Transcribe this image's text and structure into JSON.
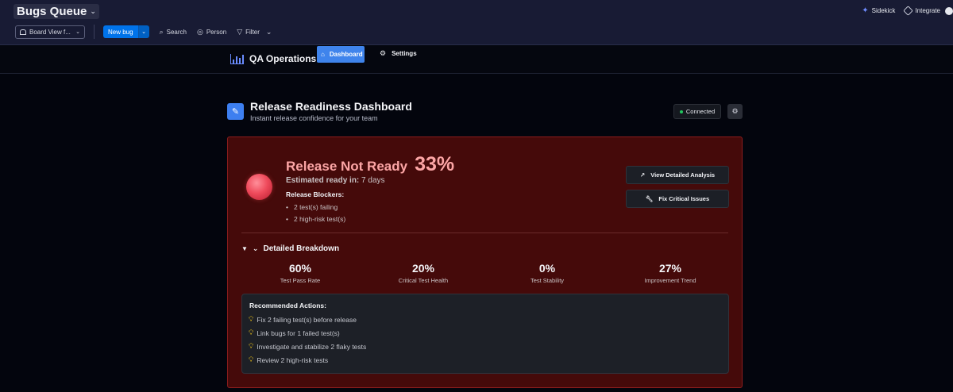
{
  "board": {
    "title": "Bugs Queue",
    "view_label": "Board View f...",
    "new_bug_label": "New bug",
    "search_label": "Search",
    "person_label": "Person",
    "filter_label": "Filter",
    "sidekick_label": "Sidekick",
    "integrate_label": "Integrate"
  },
  "app": {
    "brand": "QA Operations",
    "tabs": [
      {
        "label": "Dashboard",
        "active": true
      },
      {
        "label": "Settings",
        "active": false
      }
    ]
  },
  "dashboard": {
    "title": "Release Readiness Dashboard",
    "subtitle": "Instant release confidence for your team",
    "connection_status": "Connected",
    "status_color": "#22c55e"
  },
  "release": {
    "status_label": "Release Not Ready",
    "percent": "33%",
    "eta_label": "Estimated ready in:",
    "eta_value": "7 days",
    "blockers_title": "Release Blockers:",
    "blockers": [
      "2 test(s) failing",
      "2 high-risk test(s)"
    ],
    "actions": [
      {
        "label": "View Detailed Analysis",
        "icon": "chart-icon"
      },
      {
        "label": "Fix Critical Issues",
        "icon": "wrench-icon"
      }
    ],
    "card_color": "#450a0a",
    "accent_color": "#fca5a5"
  },
  "breakdown": {
    "title": "Detailed Breakdown",
    "metrics": [
      {
        "value": "60%",
        "label": "Test Pass Rate"
      },
      {
        "value": "20%",
        "label": "Critical Test Health"
      },
      {
        "value": "0%",
        "label": "Test Stability"
      },
      {
        "value": "27%",
        "label": "Improvement Trend"
      }
    ]
  },
  "recommendations": {
    "title": "Recommended Actions:",
    "items": [
      "Fix 2 failing test(s) before release",
      "Link bugs for 1 failed test(s)",
      "Investigate and stabilize 2 flaky tests",
      "Review 2 high-risk tests"
    ]
  }
}
